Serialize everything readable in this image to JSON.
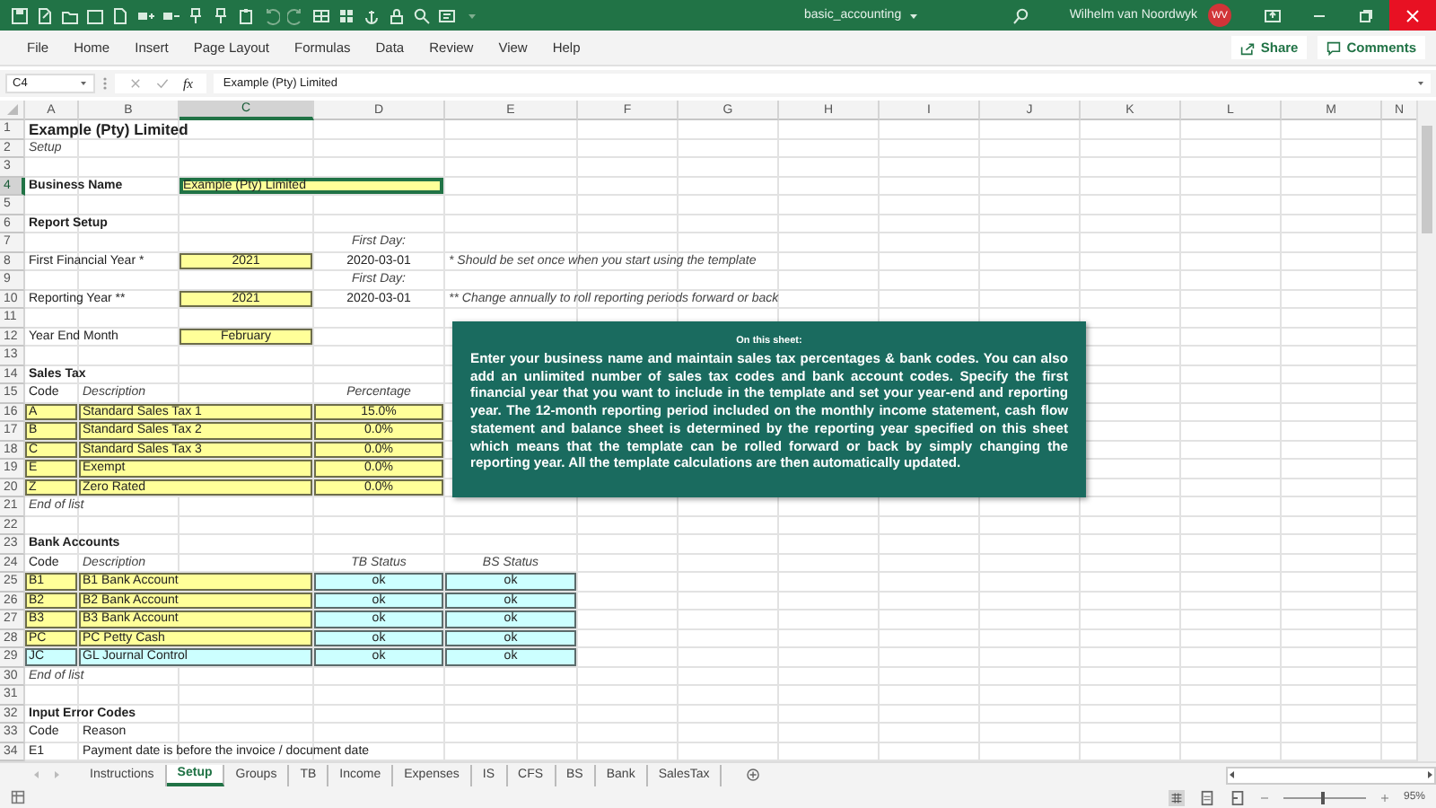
{
  "title_bar": {
    "file_name": "basic_accounting",
    "user_name": "Wilhelm van Noordwyk",
    "avatar_initials": "WV"
  },
  "menu": {
    "items": [
      "File",
      "Home",
      "Insert",
      "Page Layout",
      "Formulas",
      "Data",
      "Review",
      "View",
      "Help"
    ],
    "share": "Share",
    "comments": "Comments"
  },
  "formula_bar": {
    "cell_ref": "C4",
    "fx": "fx",
    "content": "Example (Pty) Limited"
  },
  "columns": [
    {
      "label": "A",
      "selected": false
    },
    {
      "label": "B",
      "selected": false
    },
    {
      "label": "C",
      "selected": true
    },
    {
      "label": "D",
      "selected": false
    },
    {
      "label": "E",
      "selected": false
    },
    {
      "label": "F",
      "selected": false
    },
    {
      "label": "G",
      "selected": false
    },
    {
      "label": "H",
      "selected": false
    },
    {
      "label": "I",
      "selected": false
    },
    {
      "label": "J",
      "selected": false
    },
    {
      "label": "K",
      "selected": false
    },
    {
      "label": "L",
      "selected": false
    },
    {
      "label": "M",
      "selected": false
    },
    {
      "label": "N",
      "selected": false
    }
  ],
  "rows": [
    {
      "number": "1",
      "selected": false,
      "cells": {
        "A": {
          "kind": "title",
          "text": "Example (Pty) Limited"
        }
      }
    },
    {
      "number": "2",
      "selected": false,
      "cells": {
        "A": {
          "kind": "note",
          "text": "Setup"
        }
      }
    },
    {
      "number": "3",
      "selected": false
    },
    {
      "number": "4",
      "selected": true,
      "cells": {
        "A": {
          "kind": "heading",
          "text": "Business Name"
        },
        "C": {
          "kind": "input",
          "merged": true,
          "text": "Example (Pty) Limited"
        }
      }
    },
    {
      "number": "5",
      "selected": false
    },
    {
      "number": "6",
      "selected": false,
      "cells": {
        "A": {
          "kind": "heading",
          "text": "Report Setup"
        }
      }
    },
    {
      "number": "7",
      "selected": false,
      "cells": {
        "D": {
          "kind": "caption",
          "text": "First Day:"
        }
      }
    },
    {
      "number": "8",
      "selected": false,
      "cells": {
        "A": {
          "kind": "label",
          "text": "First Financial Year *"
        },
        "C": {
          "kind": "input-center",
          "merged": false,
          "text": "2021"
        },
        "D": {
          "kind": "value",
          "text": "2020-03-01"
        },
        "E": {
          "kind": "note",
          "text": "* Should be set once when you start using the template"
        }
      }
    },
    {
      "number": "9",
      "selected": false,
      "cells": {
        "D": {
          "kind": "caption",
          "text": "First Day:"
        }
      }
    },
    {
      "number": "10",
      "selected": false,
      "cells": {
        "A": {
          "kind": "label",
          "text": "Reporting Year **"
        },
        "C": {
          "kind": "input-center",
          "merged": false,
          "text": "2021"
        },
        "D": {
          "kind": "value",
          "text": "2020-03-01"
        },
        "E": {
          "kind": "note",
          "text": "** Change annually to roll reporting periods forward or back"
        }
      }
    },
    {
      "number": "11",
      "selected": false
    },
    {
      "number": "12",
      "selected": false,
      "cells": {
        "A": {
          "kind": "label",
          "text": "Year End Month"
        },
        "C": {
          "kind": "input-center",
          "merged": false,
          "text": "February"
        }
      }
    },
    {
      "number": "13",
      "selected": false
    },
    {
      "number": "14",
      "selected": false,
      "cells": {
        "A": {
          "kind": "heading",
          "text": "Sales Tax"
        }
      }
    },
    {
      "number": "15",
      "selected": false,
      "cells": {
        "A": {
          "kind": "label",
          "text": "Code"
        },
        "B": {
          "kind": "note",
          "text": "Description"
        },
        "D": {
          "kind": "caption",
          "text": "Percentage"
        }
      }
    },
    {
      "number": "16",
      "selected": false,
      "cells": {
        "A": {
          "kind": "input",
          "merged": false,
          "text": "A"
        },
        "B": {
          "kind": "input",
          "merged": true,
          "text": "Standard Sales Tax 1"
        },
        "D": {
          "kind": "input-center",
          "merged": false,
          "text": "15.0%"
        }
      }
    },
    {
      "number": "17",
      "selected": false,
      "cells": {
        "A": {
          "kind": "input",
          "merged": false,
          "text": "B"
        },
        "B": {
          "kind": "input",
          "merged": true,
          "text": "Standard Sales Tax 2"
        },
        "D": {
          "kind": "input-center",
          "merged": false,
          "text": "0.0%"
        }
      }
    },
    {
      "number": "18",
      "selected": false,
      "cells": {
        "A": {
          "kind": "input",
          "merged": false,
          "text": "C"
        },
        "B": {
          "kind": "input",
          "merged": true,
          "text": "Standard Sales Tax 3"
        },
        "D": {
          "kind": "input-center",
          "merged": false,
          "text": "0.0%"
        }
      }
    },
    {
      "number": "19",
      "selected": false,
      "cells": {
        "A": {
          "kind": "input",
          "merged": false,
          "text": "E"
        },
        "B": {
          "kind": "input",
          "merged": true,
          "text": "Exempt"
        },
        "D": {
          "kind": "input-center",
          "merged": false,
          "text": "0.0%"
        }
      }
    },
    {
      "number": "20",
      "selected": false,
      "cells": {
        "A": {
          "kind": "input",
          "merged": false,
          "text": "Z"
        },
        "B": {
          "kind": "input",
          "merged": true,
          "text": "Zero Rated"
        },
        "D": {
          "kind": "input-center",
          "merged": false,
          "text": "0.0%"
        }
      }
    },
    {
      "number": "21",
      "selected": false,
      "cells": {
        "A": {
          "kind": "note",
          "text": "End of list"
        }
      }
    },
    {
      "number": "22",
      "selected": false
    },
    {
      "number": "23",
      "selected": false,
      "cells": {
        "A": {
          "kind": "heading",
          "text": "Bank Accounts"
        }
      }
    },
    {
      "number": "24",
      "selected": false,
      "cells": {
        "A": {
          "kind": "label",
          "text": "Code"
        },
        "B": {
          "kind": "note",
          "text": "Description"
        },
        "D": {
          "kind": "caption",
          "text": "TB Status"
        },
        "E": {
          "kind": "caption",
          "text": "BS Status"
        }
      }
    },
    {
      "number": "25",
      "selected": false,
      "cells": {
        "A": {
          "kind": "input",
          "merged": false,
          "text": "B1"
        },
        "B": {
          "kind": "input",
          "merged": true,
          "text": "B1 Bank Account"
        },
        "D": {
          "kind": "status",
          "merged": false,
          "text": "ok"
        },
        "E": {
          "kind": "status",
          "merged": false,
          "text": "ok"
        }
      }
    },
    {
      "number": "26",
      "selected": false,
      "cells": {
        "A": {
          "kind": "input",
          "merged": false,
          "text": "B2"
        },
        "B": {
          "kind": "input",
          "merged": true,
          "text": "B2 Bank Account"
        },
        "D": {
          "kind": "status",
          "merged": false,
          "text": "ok"
        },
        "E": {
          "kind": "status",
          "merged": false,
          "text": "ok"
        }
      }
    },
    {
      "number": "27",
      "selected": false,
      "cells": {
        "A": {
          "kind": "input",
          "merged": false,
          "text": "B3"
        },
        "B": {
          "kind": "input",
          "merged": true,
          "text": "B3 Bank Account"
        },
        "D": {
          "kind": "status",
          "merged": false,
          "text": "ok"
        },
        "E": {
          "kind": "status",
          "merged": false,
          "text": "ok"
        }
      }
    },
    {
      "number": "28",
      "selected": false,
      "cells": {
        "A": {
          "kind": "input",
          "merged": false,
          "text": "PC"
        },
        "B": {
          "kind": "input",
          "merged": true,
          "text": "PC Petty Cash"
        },
        "D": {
          "kind": "status",
          "merged": false,
          "text": "ok"
        },
        "E": {
          "kind": "status",
          "merged": false,
          "text": "ok"
        }
      }
    },
    {
      "number": "29",
      "selected": false,
      "cells": {
        "A": {
          "kind": "status-left",
          "merged": false,
          "text": "JC"
        },
        "B": {
          "kind": "status-left",
          "merged": true,
          "text": "GL Journal Control"
        },
        "D": {
          "kind": "status",
          "merged": false,
          "text": "ok"
        },
        "E": {
          "kind": "status",
          "merged": false,
          "text": "ok"
        }
      }
    },
    {
      "number": "30",
      "selected": false,
      "cells": {
        "A": {
          "kind": "note",
          "text": "End of list"
        }
      }
    },
    {
      "number": "31",
      "selected": false
    },
    {
      "number": "32",
      "selected": false,
      "cells": {
        "A": {
          "kind": "heading",
          "text": "Input Error Codes"
        }
      }
    },
    {
      "number": "33",
      "selected": false,
      "cells": {
        "A": {
          "kind": "label",
          "text": "Code"
        },
        "B": {
          "kind": "label",
          "text": "Reason"
        }
      }
    },
    {
      "number": "34",
      "selected": false,
      "cells": {
        "A": {
          "kind": "label",
          "text": "E1"
        },
        "B": {
          "kind": "label",
          "text": "Payment date is before the invoice / document date"
        }
      }
    }
  ],
  "note": {
    "title": "On this sheet:",
    "body": "Enter your business name and maintain sales tax percentages & bank codes. You can also add an unlimited number of sales tax codes and bank account codes. Specify the first financial year that you want to include in the template and set your year-end and reporting year. The 12-month reporting period included on the monthly income statement, cash flow statement and balance sheet is determined by the reporting year specified on this sheet which means that the template can be rolled forward or back by simply changing the reporting year. All the template calculations are then automatically updated."
  },
  "sheet_tabs": [
    {
      "label": "Instructions",
      "selected": false
    },
    {
      "label": "Setup",
      "selected": true
    },
    {
      "label": "Groups",
      "selected": false
    },
    {
      "label": "TB",
      "selected": false
    },
    {
      "label": "Income",
      "selected": false
    },
    {
      "label": "Expenses",
      "selected": false
    },
    {
      "label": "IS",
      "selected": false
    },
    {
      "label": "CFS",
      "selected": false
    },
    {
      "label": "BS",
      "selected": false
    },
    {
      "label": "Bank",
      "selected": false
    },
    {
      "label": "SalesTax",
      "selected": false
    }
  ],
  "status_bar": {
    "zoom": {
      "level": 0.48,
      "reading": "95%"
    }
  }
}
